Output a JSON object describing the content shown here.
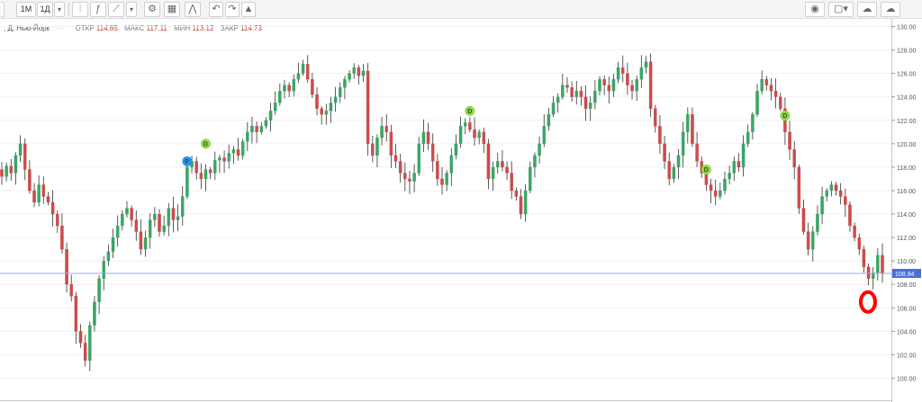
{
  "toolbar": {
    "interval_1": "1Д",
    "interval_2": "1М",
    "interval_3": "1Д",
    "dropdown_icon": "chevron-down-icon",
    "icons": [
      "candles-icon",
      "indicators-icon",
      "compare-icon",
      "settings-icon",
      "templates-icon",
      "undo-icon",
      "redo-icon",
      "alert-icon",
      "camera-icon",
      "layout-icon",
      "cloud-load-icon",
      "cloud-save-icon"
    ]
  },
  "legend": {
    "symbol": ", Д, Нью-Йорк",
    "open_label": "ОТКР",
    "open_value": "114.85",
    "high_label": "МАКС",
    "high_value": "117.11",
    "low_label": "МИН",
    "low_value": "113.12",
    "close_label": "ЗАКР",
    "close_value": "114.73"
  },
  "colors": {
    "up": "#3aa565",
    "down": "#cc4b4b",
    "price_line": "#8fb2e8",
    "price_tag": "#4a6fd8",
    "dividend": "#8ed84e",
    "split": "#2196f3",
    "marker": "#ff0000"
  },
  "chart_data": {
    "type": "candlestick",
    "y_ticks": [
      "100.00",
      "102.00",
      "104.00",
      "106.00",
      "108.00",
      "110.00",
      "112.00",
      "114.00",
      "116.00",
      "118.00",
      "120.00",
      "122.00",
      "124.00",
      "126.00",
      "128.00",
      "130.00"
    ],
    "ylim": [
      98.9,
      130.3
    ],
    "last_price": 108.94,
    "last_price_label": "108.94",
    "dividend_marker_text": "D",
    "split_marker_text": "P",
    "bar_count": 190,
    "closes": [
      117.2,
      118.1,
      117.5,
      119.0,
      120.0,
      117.8,
      116.0,
      115.0,
      116.5,
      115.5,
      115.0,
      114.0,
      113.0,
      111.0,
      108.0,
      107.0,
      104.0,
      103.0,
      101.5,
      104.5,
      106.5,
      108.5,
      110.0,
      110.8,
      112.0,
      113.0,
      114.0,
      114.5,
      113.5,
      112.5,
      111.0,
      112.0,
      113.5,
      114.0,
      112.5,
      113.0,
      114.5,
      113.5,
      113.8,
      115.5,
      118.0,
      118.5,
      117.5,
      117.0,
      117.8,
      117.5,
      118.6,
      118.8,
      118.5,
      119.2,
      119.5,
      119.0,
      120.2,
      121.0,
      121.5,
      121.0,
      121.5,
      122.0,
      122.8,
      123.5,
      124.5,
      125.0,
      124.5,
      125.5,
      126.0,
      126.8,
      125.5,
      124.2,
      123.0,
      122.5,
      122.8,
      123.5,
      124.0,
      124.8,
      125.5,
      126.0,
      126.5,
      125.8,
      126.2,
      120.0,
      119.0,
      120.5,
      121.5,
      121.0,
      119.0,
      118.5,
      117.5,
      117.0,
      116.8,
      117.5,
      120.0,
      121.0,
      120.0,
      118.5,
      117.0,
      116.5,
      117.5,
      119.0,
      120.0,
      121.5,
      121.8,
      121.2,
      120.5,
      121.0,
      120.0,
      117.0,
      118.0,
      118.5,
      118.0,
      117.5,
      116.0,
      115.5,
      114.0,
      116.0,
      118.0,
      119.0,
      120.0,
      121.5,
      122.5,
      123.5,
      124.0,
      125.0,
      124.8,
      124.0,
      124.5,
      124.0,
      123.0,
      123.5,
      124.5,
      125.5,
      125.0,
      124.5,
      125.5,
      126.5,
      126.0,
      125.0,
      124.5,
      125.5,
      126.5,
      127.0,
      123.0,
      121.5,
      120.0,
      118.5,
      117.0,
      118.0,
      119.0,
      121.0,
      122.5,
      120.0,
      118.5,
      117.5,
      116.5,
      116.0,
      115.5,
      116.0,
      117.0,
      117.5,
      118.5,
      118.0,
      120.0,
      121.0,
      122.5,
      124.5,
      125.5,
      125.0,
      124.5,
      124.0,
      123.0,
      121.0,
      119.5,
      118.0,
      114.5,
      112.5,
      111.0,
      112.5,
      114.0,
      115.5,
      116.0,
      116.5,
      116.0,
      115.5,
      114.8,
      113.0,
      112.0,
      111.0,
      109.5,
      108.5,
      109.0,
      110.5,
      108.94
    ]
  }
}
